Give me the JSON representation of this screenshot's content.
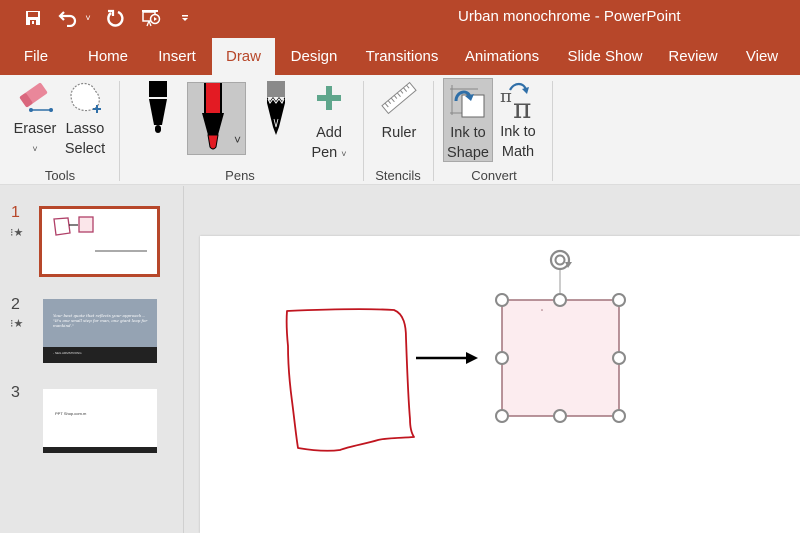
{
  "window": {
    "title": "Urban monochrome  -  PowerPoint",
    "accent_color": "#b7472a"
  },
  "quick_access": [
    {
      "name": "save-icon",
      "tooltip": "Save"
    },
    {
      "name": "undo-icon",
      "tooltip": "Undo"
    },
    {
      "name": "redo-icon",
      "tooltip": "Redo"
    },
    {
      "name": "present-from-beginning-icon",
      "tooltip": "Start From Beginning"
    },
    {
      "name": "customize-qat-icon",
      "tooltip": "Customize Quick Access Toolbar"
    }
  ],
  "tabs": [
    {
      "label": "File"
    },
    {
      "label": "Home"
    },
    {
      "label": "Insert"
    },
    {
      "label": "Draw",
      "active": true
    },
    {
      "label": "Design"
    },
    {
      "label": "Transitions"
    },
    {
      "label": "Animations"
    },
    {
      "label": "Slide Show"
    },
    {
      "label": "Review"
    },
    {
      "label": "View"
    }
  ],
  "ribbon": {
    "groups": {
      "tools": "Tools",
      "pens": "Pens",
      "stencils": "Stencils",
      "convert": "Convert"
    },
    "eraser": {
      "line1": "Eraser",
      "caret": "˅"
    },
    "lasso": {
      "line1": "Lasso",
      "line2": "Select"
    },
    "add_pen": {
      "line1": "Add",
      "line2": "Pen",
      "caret": "˅"
    },
    "ruler": {
      "line1": "Ruler"
    },
    "ink_to_shape": {
      "line1": "Ink to",
      "line2": "Shape",
      "pressed": true
    },
    "ink_to_math": {
      "line1": "Ink to",
      "line2": "Math"
    },
    "pens": [
      {
        "name": "black-pen",
        "color": "#000000"
      },
      {
        "name": "red-pen",
        "color": "#e31b23",
        "selected": true
      },
      {
        "name": "pencil",
        "color": "#808080"
      }
    ],
    "pen_caret": "˅"
  },
  "slides": [
    {
      "number": "1",
      "has_animation": true,
      "selected": true
    },
    {
      "number": "2",
      "has_animation": true,
      "quote": "Your best quote that reflects your approach... \"It's one small step for man, one giant leap for mankind.\"",
      "author": "- NEIL ARMSTRONG"
    },
    {
      "number": "3",
      "has_animation": false,
      "text": "PPT Shop.com.m"
    }
  ],
  "canvas": {
    "ink_color": "#c0151f",
    "shape_fill": "#fcecef",
    "shape_border": "#a0727a",
    "arrow_color": "#000000"
  }
}
